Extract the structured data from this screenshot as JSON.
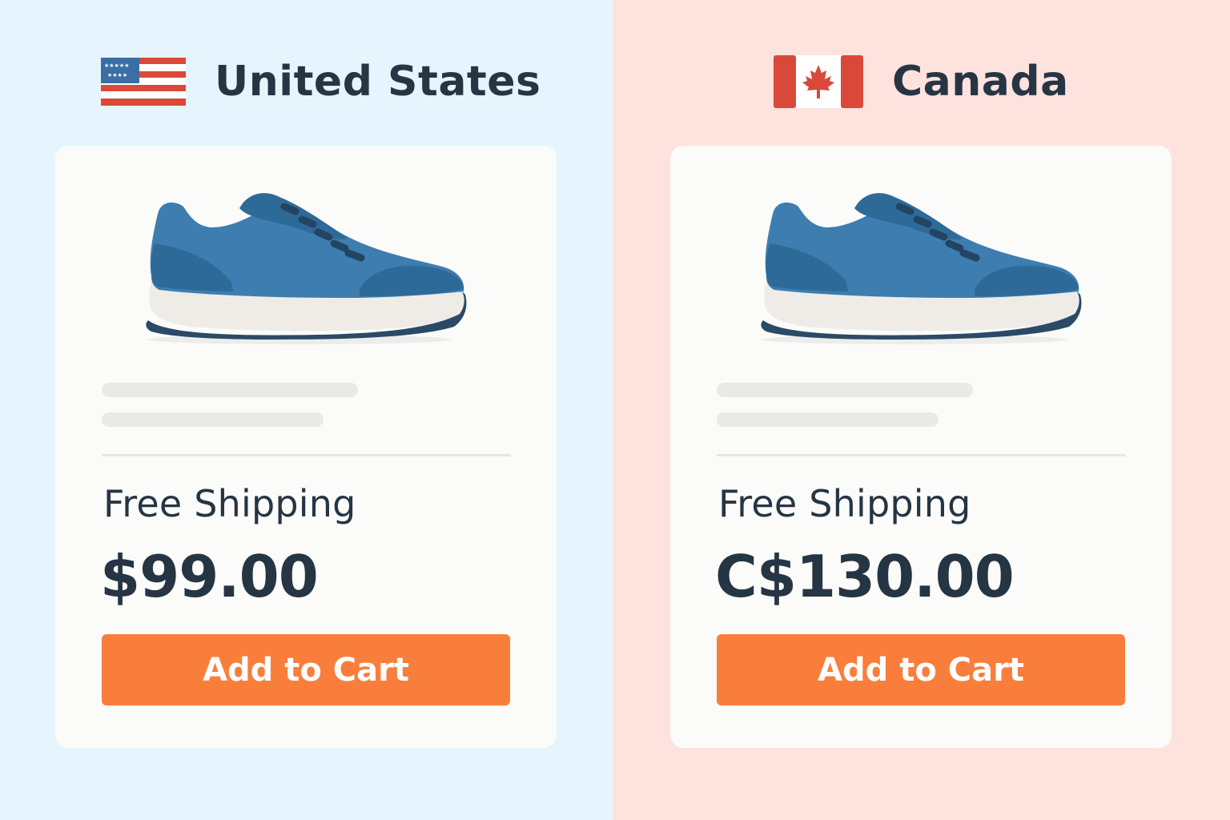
{
  "regions": [
    {
      "id": "us",
      "country": "United States",
      "flag_icon": "us-flag-icon",
      "background": "#e6f4fd",
      "product": {
        "image_icon": "blue-sneaker-icon",
        "shipping": "Free Shipping",
        "price": "$99.00",
        "cta": "Add to Cart"
      }
    },
    {
      "id": "ca",
      "country": "Canada",
      "flag_icon": "canada-flag-icon",
      "background": "#fde2de",
      "product": {
        "image_icon": "blue-sneaker-icon",
        "shipping": "Free Shipping",
        "price": "C$130.00",
        "cta": "Add to Cart"
      }
    }
  ],
  "colors": {
    "text": "#263544",
    "button": "#f97e3b",
    "card": "#fbfbf9",
    "shoe": "#3e7db0"
  }
}
